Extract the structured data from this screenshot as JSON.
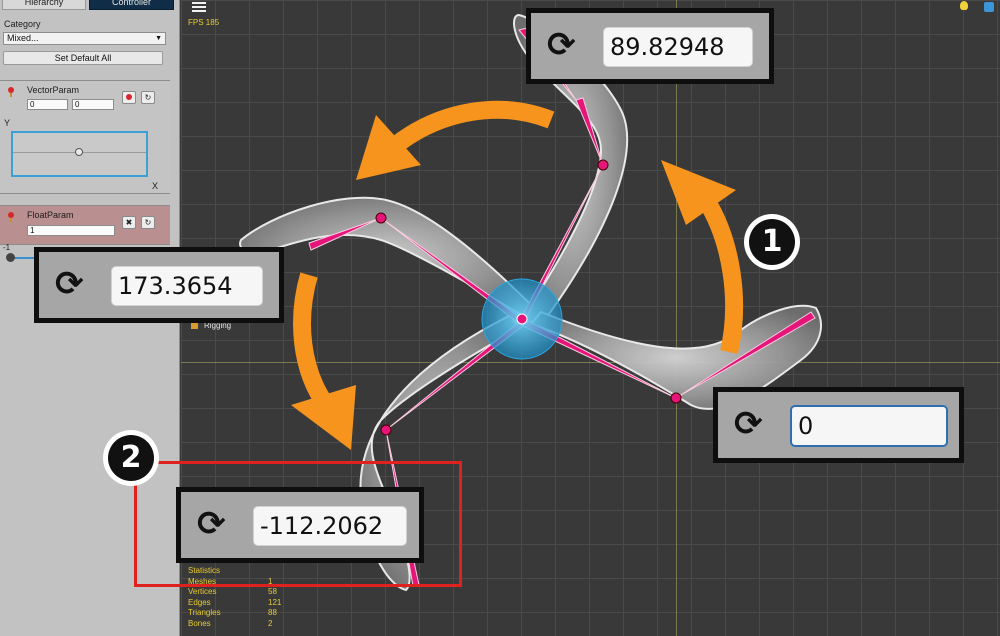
{
  "tabs": {
    "hierarchy": "Hierarchy",
    "controller": "Controller"
  },
  "category": {
    "label": "Category",
    "value": "Mixed..."
  },
  "set_default_all": "Set Default All",
  "vector_param": {
    "name": "VectorParam",
    "x_value": "0",
    "y_value": "0",
    "axis_y": "Y",
    "axis_x": "X"
  },
  "float_param": {
    "name": "FloatParam",
    "value": "1",
    "min_label": "-1"
  },
  "viewport": {
    "fps": "FPS 185",
    "rigging_label": "Rigging",
    "stats": {
      "title": "Statistics",
      "rows": [
        {
          "label": "Meshes",
          "value": "1"
        },
        {
          "label": "Vertices",
          "value": "58"
        },
        {
          "label": "Edges",
          "value": "121"
        },
        {
          "label": "Triangles",
          "value": "88"
        },
        {
          "label": "Bones",
          "value": "2"
        }
      ]
    }
  },
  "callouts": {
    "top": "89.82948",
    "left": "173.3654",
    "right": "0",
    "bottom": "-112.2062"
  },
  "badges": {
    "one": "1",
    "two": "2"
  },
  "colors": {
    "arrow": "#f7941d",
    "bone": "#e5157a",
    "highlight": "#e0221e",
    "panel_active": "#0f2d46"
  },
  "icons": {
    "rotate": "⟳"
  }
}
